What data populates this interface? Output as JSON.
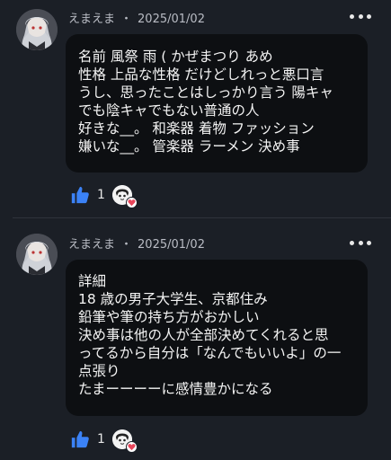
{
  "colors": {
    "background": "#1b1f26",
    "bubble": "#0d0f12",
    "like_blue": "#3b82f6",
    "heart_red": "#e8455a"
  },
  "posts": [
    {
      "author": "えまえま",
      "separator": "・",
      "date": "2025/01/02",
      "lines": [
        "名前  風祭  雨 ( かぜまつり  あめ",
        "性格  上品な性格  だけどしれっと悪口言",
        "うし、思ったことはしっかり言う  陽キャ",
        "でも陰キャでもない普通の人",
        "好きな__。  和楽器  着物  ファッション",
        "嫌いな__。  管楽器  ラーメン  決め事"
      ],
      "like_count": "1",
      "icons": {
        "like": "thumbs-up-icon",
        "more": "more-dots-icon",
        "reaction": "heart-icon"
      }
    },
    {
      "author": "えまえま",
      "separator": "・",
      "date": "2025/01/02",
      "lines": [
        "詳細",
        "18 歳の男子大学生、京都住み",
        "鉛筆や筆の持ち方がおかしい",
        "決め事は他の人が全部決めてくれると思",
        "ってるから自分は「なんでもいいよ」の一",
        "点張り",
        "たまーーーーに感情豊かになる"
      ],
      "like_count": "1",
      "icons": {
        "like": "thumbs-up-icon",
        "more": "more-dots-icon",
        "reaction": "heart-icon"
      }
    }
  ]
}
